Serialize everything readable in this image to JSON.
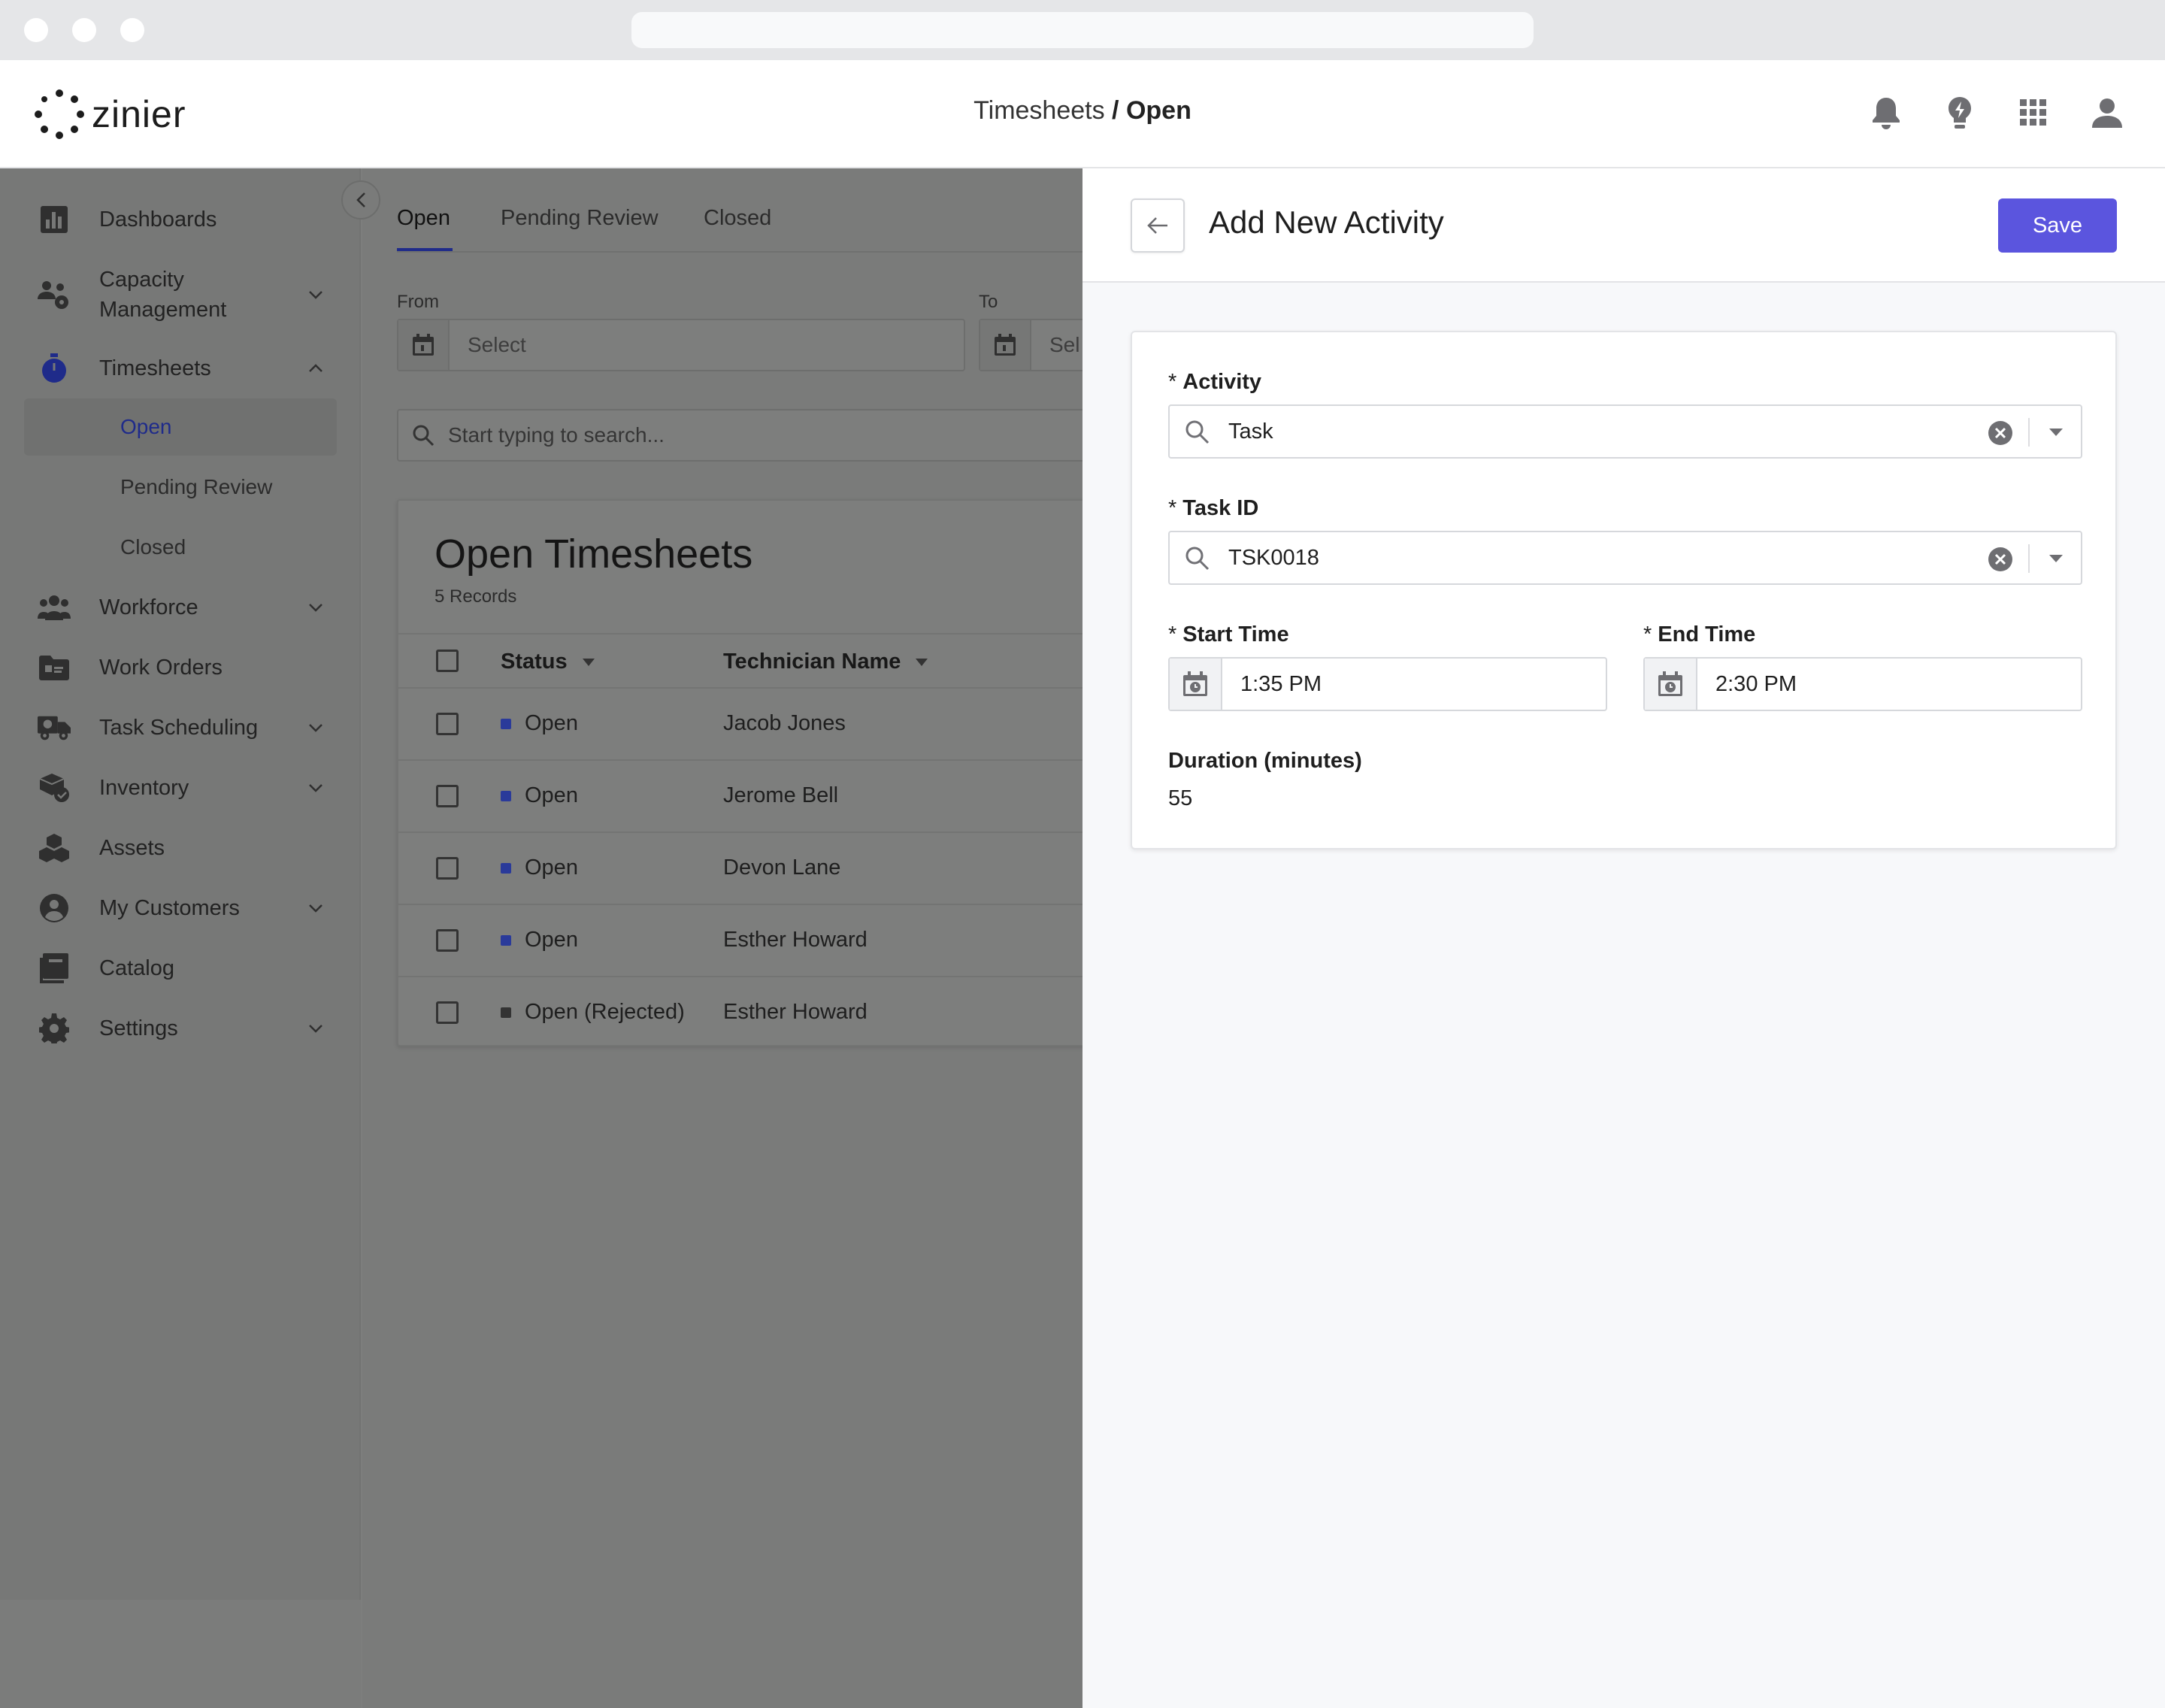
{
  "app": {
    "logo_text": "zinier",
    "breadcrumb_parent": "Timesheets",
    "breadcrumb_separator": " / ",
    "breadcrumb_current": "Open"
  },
  "header_icons": [
    "bell-icon",
    "lightbulb-icon",
    "apps-grid-icon",
    "user-icon"
  ],
  "sidebar": {
    "items": [
      {
        "label": "Dashboards",
        "icon": "bar-chart-icon"
      },
      {
        "label": "Capacity",
        "label2": "Management",
        "icon": "people-settings-icon"
      },
      {
        "label": "Timesheets",
        "icon": "stopwatch-icon"
      },
      {
        "label": "Workforce",
        "icon": "group-icon"
      },
      {
        "label": "Work Orders",
        "icon": "folder-icon"
      },
      {
        "label": "Task Scheduling",
        "icon": "truck-icon"
      },
      {
        "label": "Inventory",
        "icon": "package-check-icon"
      },
      {
        "label": "Assets",
        "icon": "boxes-icon"
      },
      {
        "label": "My Customers",
        "icon": "account-circle-icon"
      },
      {
        "label": "Catalog",
        "icon": "book-icon"
      },
      {
        "label": "Settings",
        "icon": "gear-icon"
      }
    ],
    "timesheet_sub": [
      "Open",
      "Pending Review",
      "Closed"
    ]
  },
  "main": {
    "tabs": [
      "Open",
      "Pending Review",
      "Closed"
    ],
    "from_label": "From",
    "to_label": "To",
    "date_placeholder": "Select",
    "date_placeholder_clipped": "Sel",
    "search_placeholder": "Start typing to search...",
    "card_title": "Open Timesheets",
    "card_sub": "5 Records",
    "columns": [
      "Status",
      "Technician Name"
    ],
    "rows": [
      {
        "status": "Open",
        "name": "Jacob Jones",
        "color": "#2a3a9a"
      },
      {
        "status": "Open",
        "name": "Jerome Bell",
        "color": "#2a3a9a"
      },
      {
        "status": "Open",
        "name": "Devon Lane",
        "color": "#2a3a9a"
      },
      {
        "status": "Open",
        "name": "Esther Howard",
        "color": "#2a3a9a"
      },
      {
        "status": "Open (Rejected)",
        "name": "Esther Howard",
        "color": "#333333"
      }
    ]
  },
  "panel": {
    "title": "Add New Activity",
    "save_label": "Save",
    "required_mark": "*",
    "activity_label": "Activity",
    "activity_value": "Task",
    "task_id_label": "Task ID",
    "task_id_value": "TSK0018",
    "start_label": "Start Time",
    "start_value": "1:35 PM",
    "end_label": "End Time",
    "end_value": "2:30 PM",
    "duration_label": "Duration (minutes)",
    "duration_value": "55"
  },
  "colors": {
    "accent": "#5b55de",
    "brand_dark": "#1f2b8a"
  }
}
